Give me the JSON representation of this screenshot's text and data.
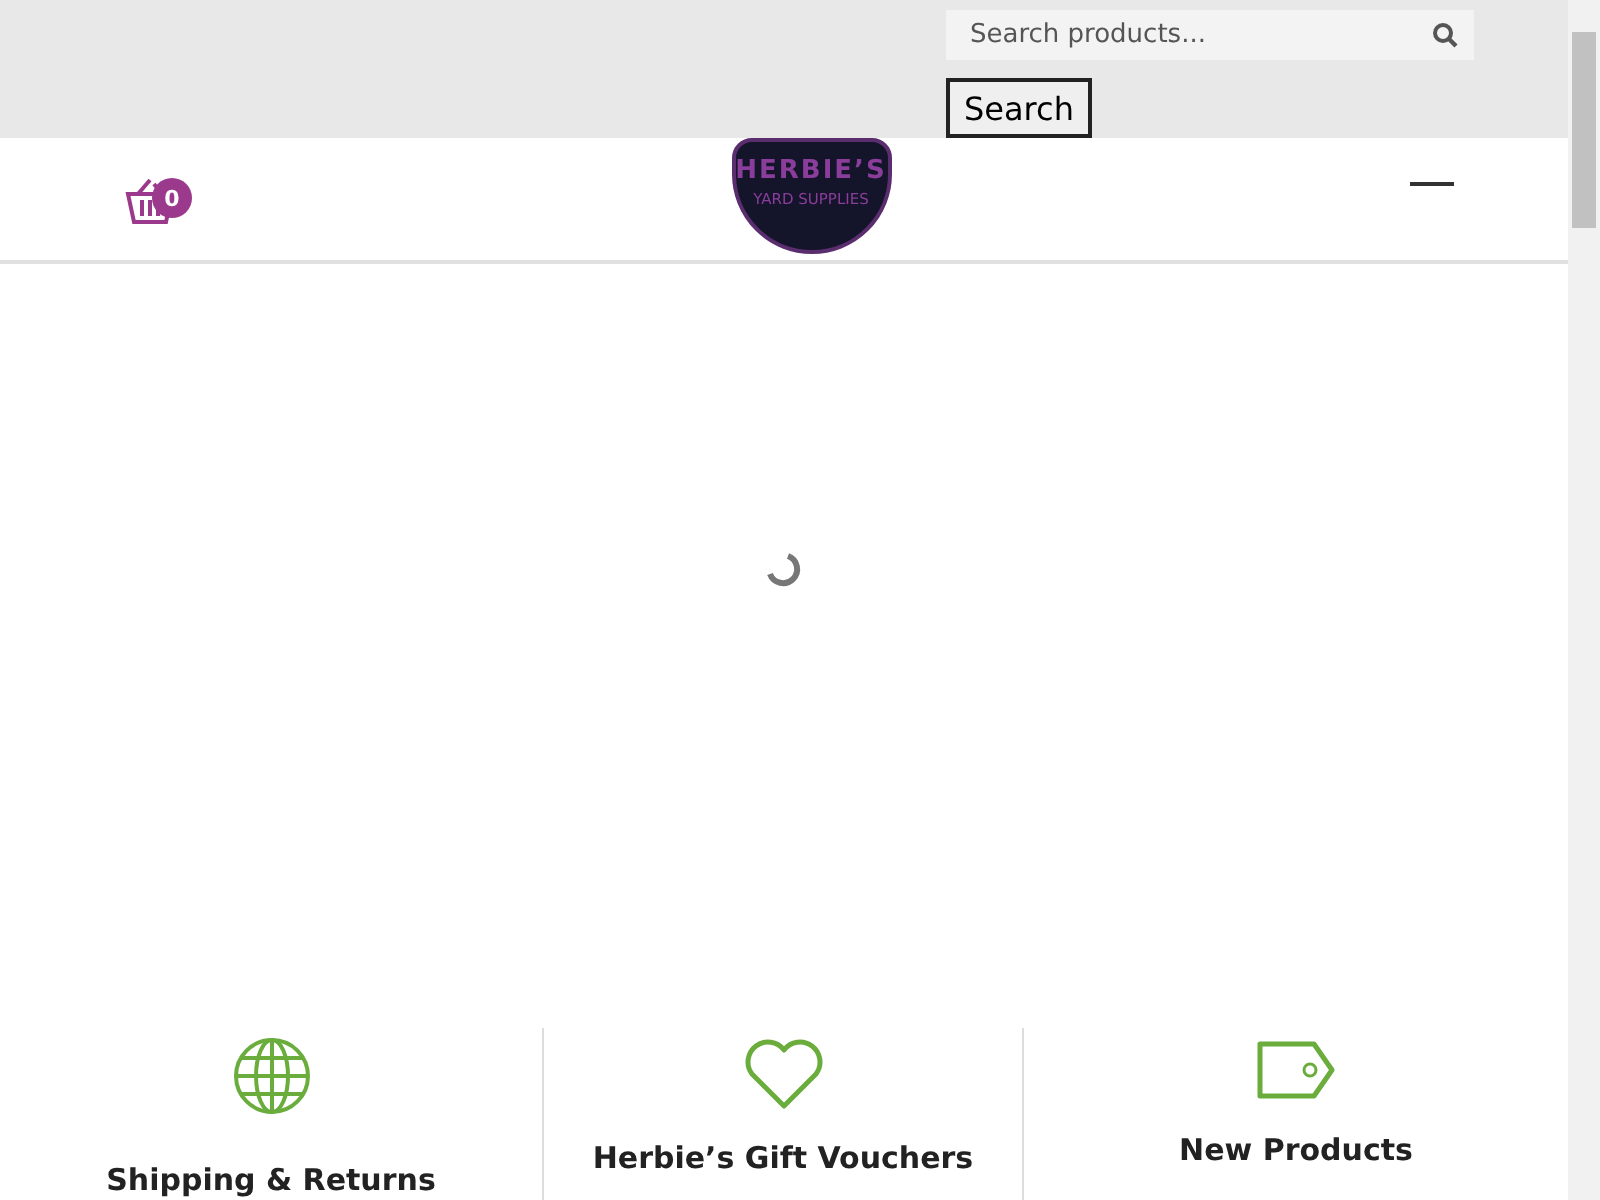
{
  "search": {
    "placeholder": "Search products...",
    "button": "Search"
  },
  "header": {
    "cart_count": "0",
    "logo": {
      "line_1": "HERBIE’S",
      "line_2": "YARD SUPPLIES"
    }
  },
  "features": [
    {
      "kind": "globe",
      "title": "Shipping & Returns"
    },
    {
      "kind": "heart",
      "title": "Herbie’s Gift Vouchers"
    },
    {
      "kind": "tag",
      "title": "New Products"
    }
  ]
}
